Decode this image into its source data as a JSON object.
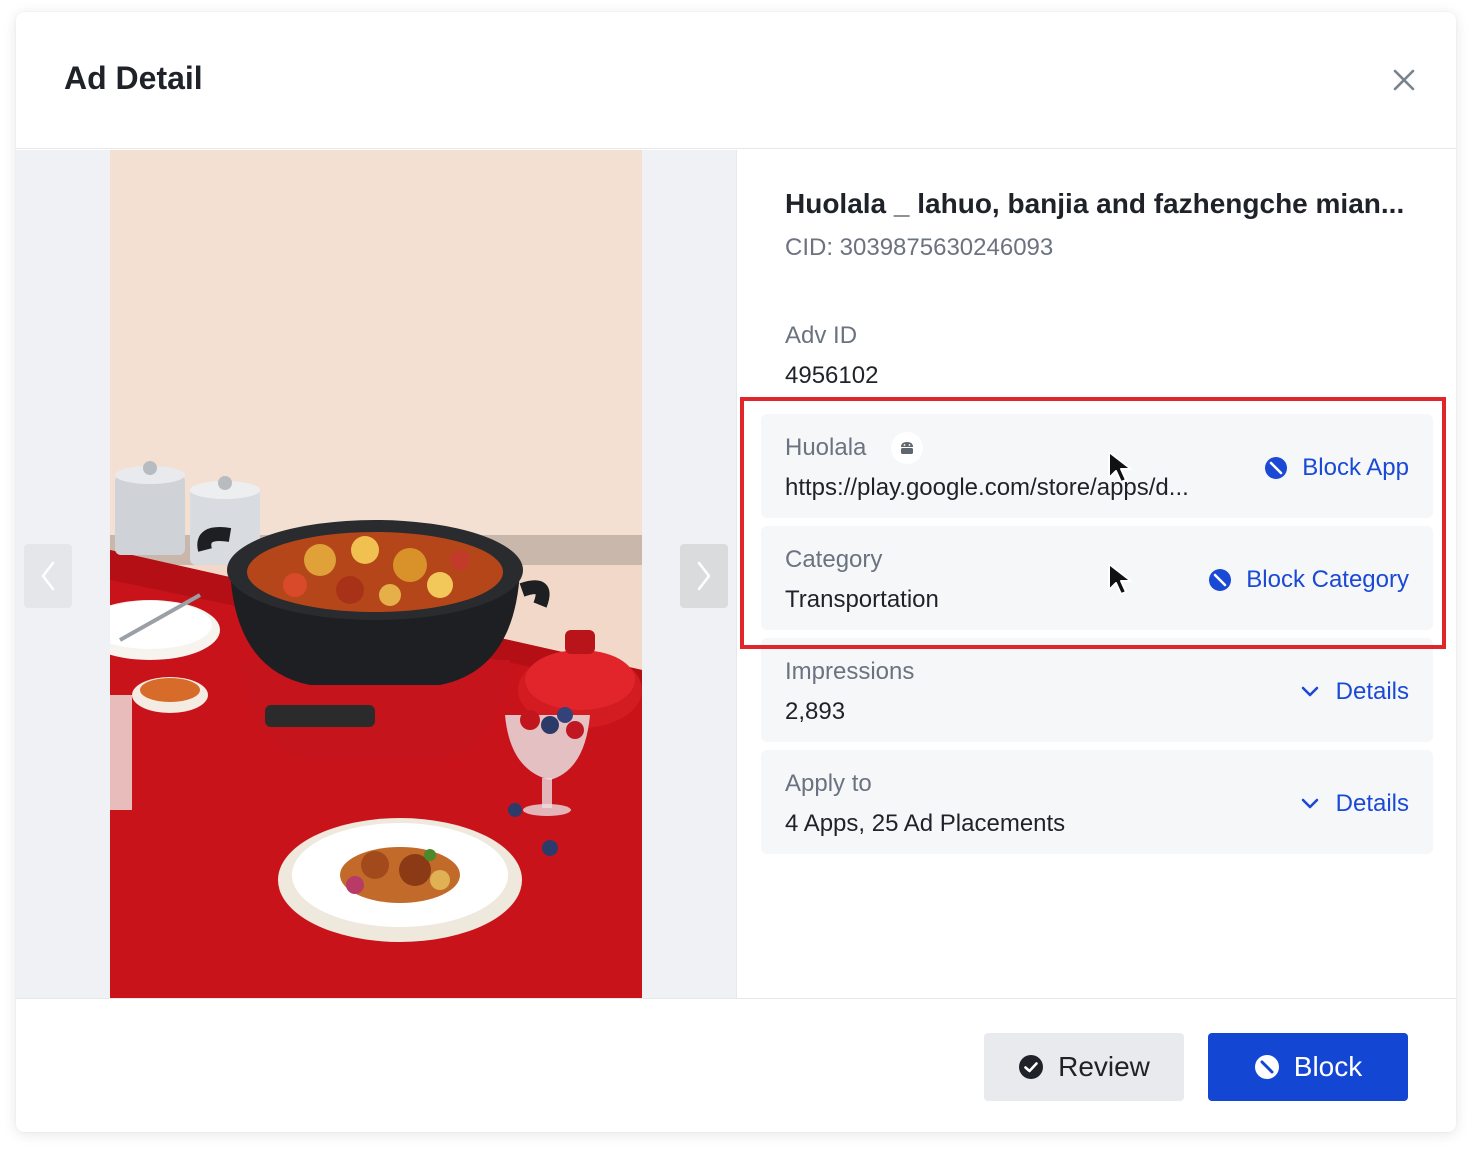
{
  "modal": {
    "title": "Ad Detail"
  },
  "ad": {
    "title": "Huolala _ lahuo, banjia and fazhengche mian...",
    "cid": "CID: 3039875630246093",
    "adv_id_label": "Adv ID",
    "adv_id_value": "4956102"
  },
  "app_card": {
    "label": "Huolala",
    "platform_icon": "android-icon",
    "url": "https://play.google.com/store/apps/d...",
    "action_label": "Block App"
  },
  "category_card": {
    "label": "Category",
    "value": "Transportation",
    "action_label": "Block Category"
  },
  "impressions_card": {
    "label": "Impressions",
    "value": "2,893",
    "action_label": "Details"
  },
  "apply_card": {
    "label": "Apply to",
    "value": "4 Apps, 25 Ad Placements",
    "action_label": "Details"
  },
  "footer": {
    "review_label": "Review",
    "block_label": "Block"
  },
  "colors": {
    "accent": "#1446d4",
    "link": "#1a49d6",
    "highlight": "#e0252b"
  }
}
